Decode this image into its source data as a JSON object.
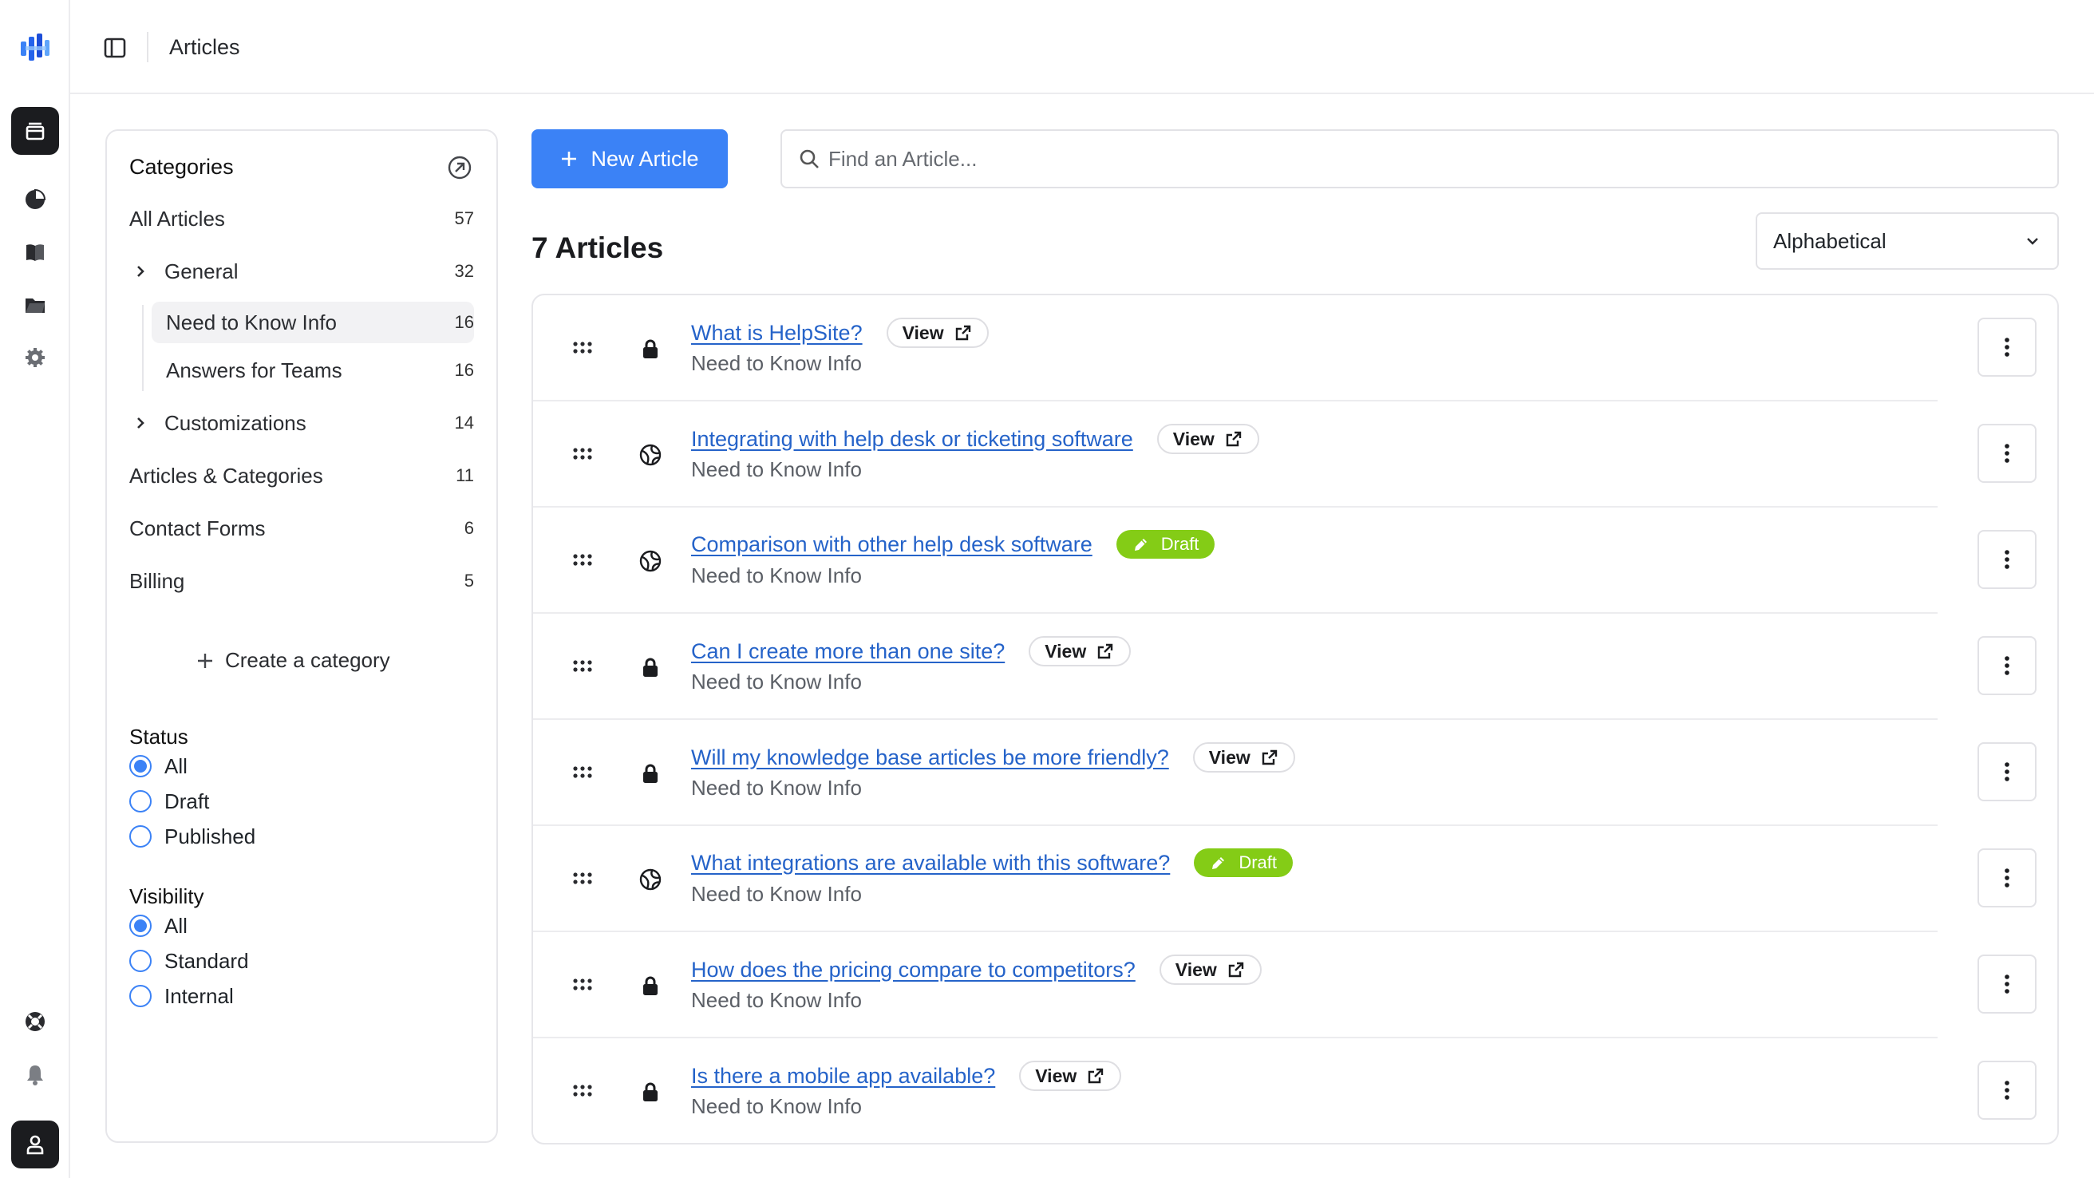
{
  "topbar": {
    "title": "Articles"
  },
  "rail": {
    "icons": [
      "logo-icon",
      "articles-icon",
      "analytics-icon",
      "book-icon",
      "folder-icon",
      "settings-icon",
      "help-icon",
      "bell-icon",
      "user-icon"
    ]
  },
  "categories": {
    "title": "Categories",
    "all": {
      "label": "All Articles",
      "count": "57"
    },
    "general": {
      "label": "General",
      "count": "32"
    },
    "need_to_know": {
      "label": "Need to Know Info",
      "count": "16"
    },
    "answers_teams": {
      "label": "Answers for Teams",
      "count": "16"
    },
    "customizations": {
      "label": "Customizations",
      "count": "14"
    },
    "articles_categories": {
      "label": "Articles & Categories",
      "count": "11"
    },
    "contact_forms": {
      "label": "Contact Forms",
      "count": "6"
    },
    "billing": {
      "label": "Billing",
      "count": "5"
    },
    "create": "Create a category"
  },
  "filters": {
    "status": {
      "title": "Status",
      "options": [
        "All",
        "Draft",
        "Published"
      ],
      "selected": "All"
    },
    "visibility": {
      "title": "Visibility",
      "options": [
        "All",
        "Standard",
        "Internal"
      ],
      "selected": "All"
    }
  },
  "main": {
    "new_article": "New Article",
    "search_placeholder": "Find an Article...",
    "count_title": "7 Articles",
    "sort": "Alphabetical",
    "view_label": "View",
    "draft_label": "Draft",
    "articles": [
      {
        "title": "What is HelpSite?",
        "category": "Need to Know Info",
        "visibility": "lock",
        "status": "view"
      },
      {
        "title": "Integrating with help desk or ticketing software",
        "category": "Need to Know Info",
        "visibility": "globe",
        "status": "view"
      },
      {
        "title": "Comparison with other help desk software",
        "category": "Need to Know Info",
        "visibility": "globe",
        "status": "draft"
      },
      {
        "title": "Can I create more than one site?",
        "category": "Need to Know Info",
        "visibility": "lock",
        "status": "view"
      },
      {
        "title": "Will my knowledge base articles be more friendly?",
        "category": "Need to Know Info",
        "visibility": "lock",
        "status": "view"
      },
      {
        "title": "What integrations are available with this software?",
        "category": "Need to Know Info",
        "visibility": "globe",
        "status": "draft"
      },
      {
        "title": "How does the pricing compare to competitors?",
        "category": "Need to Know Info",
        "visibility": "lock",
        "status": "view"
      },
      {
        "title": "Is there a mobile app available?",
        "category": "Need to Know Info",
        "visibility": "lock",
        "status": "view"
      }
    ]
  },
  "colors": {
    "accent": "#3b82f6",
    "draft": "#84cc16",
    "link": "#2563c9",
    "dark": "#1b1c1f"
  }
}
